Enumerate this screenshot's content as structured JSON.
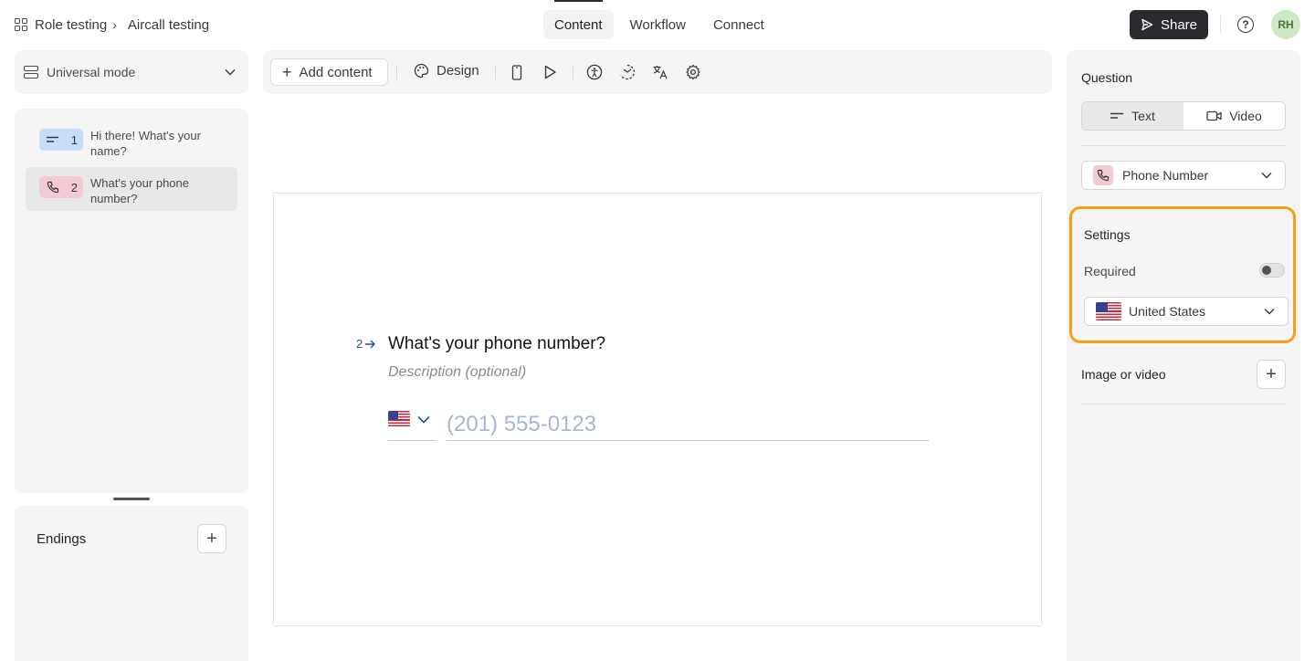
{
  "breadcrumb": {
    "workspace": "Role testing",
    "separator": "›",
    "form": "Aircall testing"
  },
  "nav_tabs": [
    {
      "label": "Content",
      "active": true
    },
    {
      "label": "Workflow",
      "active": false
    },
    {
      "label": "Connect",
      "active": false
    }
  ],
  "header": {
    "share_label": "Share",
    "help_label": "?",
    "avatar_initials": "RH"
  },
  "left": {
    "mode_label": "Universal mode",
    "questions": [
      {
        "number": "1",
        "text": "Hi there! What's your name?",
        "icon": "short-text-icon",
        "color": "#c6dcf7"
      },
      {
        "number": "2",
        "text": "What's your phone number?",
        "icon": "phone-icon",
        "color": "#f3c9d3",
        "active": true
      }
    ],
    "endings_label": "Endings",
    "endings_add": "+"
  },
  "toolbar": {
    "add_content_label": "Add content",
    "add_content_plus": "+",
    "design_label": "Design",
    "icons": [
      "mobile-preview-icon",
      "play-icon",
      "accessibility-icon",
      "loader-icon",
      "translate-icon",
      "settings-gear-icon"
    ]
  },
  "canvas": {
    "question_number": "2",
    "question_title": "What's your phone number?",
    "description_placeholder": "Description (optional)",
    "phone_placeholder": "(201) 555-0123",
    "country_flag": "us-flag-icon"
  },
  "right": {
    "question_heading": "Question",
    "mode_text": "Text",
    "mode_video": "Video",
    "type_label": "Phone Number",
    "settings_heading": "Settings",
    "required_label": "Required",
    "required_value": false,
    "country_label": "United States",
    "image_video_label": "Image or video",
    "image_add": "+",
    "highlight_color": "#f5a010"
  }
}
